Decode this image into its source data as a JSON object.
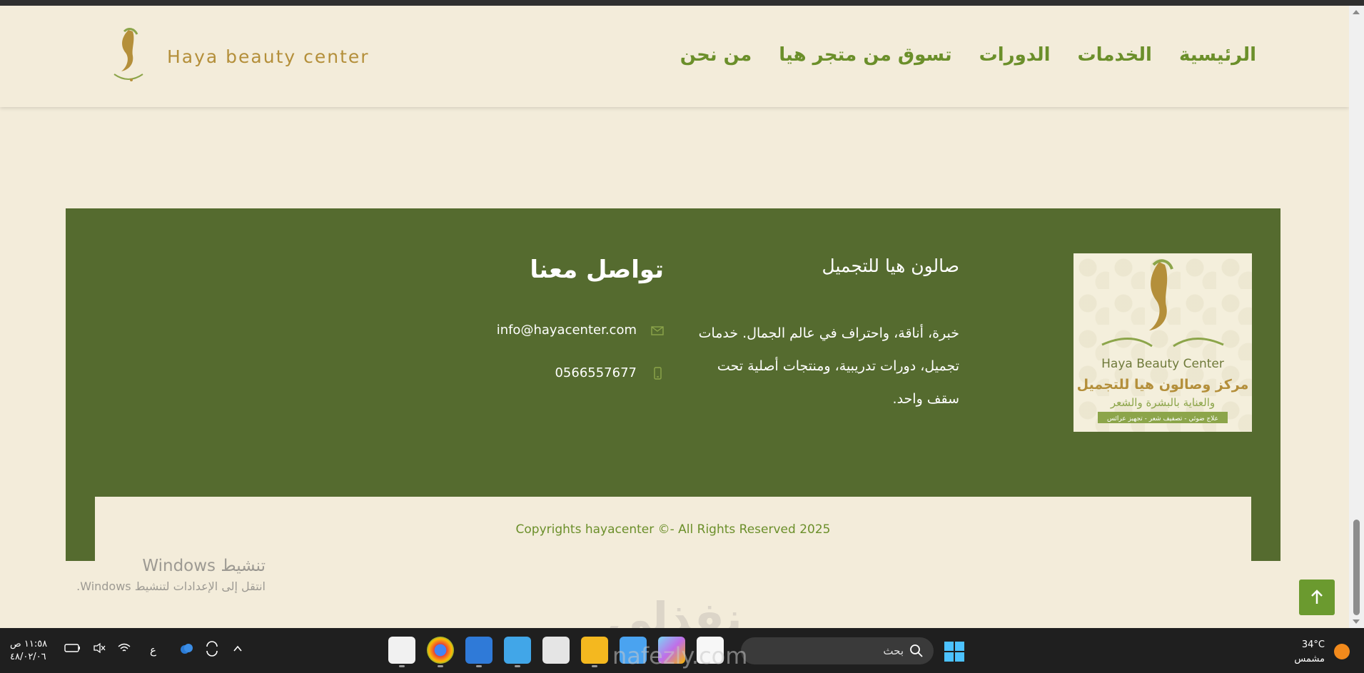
{
  "header": {
    "brand_name": "Haya beauty center",
    "nav": [
      "الرئيسية",
      "الخدمات",
      "الدورات",
      "تسوق من متجر هيا",
      "من نحن"
    ]
  },
  "footer": {
    "logo": {
      "name_en": "Haya Beauty Center",
      "title_ar": "مركز وصالون هيا للتجميل",
      "subtitle_ar": "والعناية بالبشرة والشعر",
      "services_ar": "علاج ضوئي - تصفيف شعر - تجهيز عرائس"
    },
    "about_title": "صالون هيا للتجميل",
    "about_text": "خبرة، أناقة، واحتراف في عالم الجمال. خدمات تجميل، دورات تدريبية، ومنتجات أصلية تحت سقف واحد.",
    "contact_title": "تواصل معنا",
    "email": "info@hayacenter.com",
    "phone": "0566557677",
    "copyright": "Copyrights hayacenter ©- All Rights Reserved 2025"
  },
  "activation": {
    "title": "تنشيط Windows",
    "subtitle": "انتقل إلى الإعدادات لتنشيط Windows."
  },
  "watermark": {
    "arabic": "نفذلي",
    "latin": "nafezly.com"
  },
  "taskbar": {
    "time": "١١:٥٨ ص",
    "date": "٤٨/٠٢/٠٦",
    "lang": "ع",
    "search_label": "بحث",
    "temperature": "34°C",
    "weather": "مشمس"
  },
  "colors": {
    "brand_gold": "#b48f3a",
    "nav_green": "#6b8f2a",
    "footer_green": "#556b2f",
    "cream": "#f3ecda"
  }
}
